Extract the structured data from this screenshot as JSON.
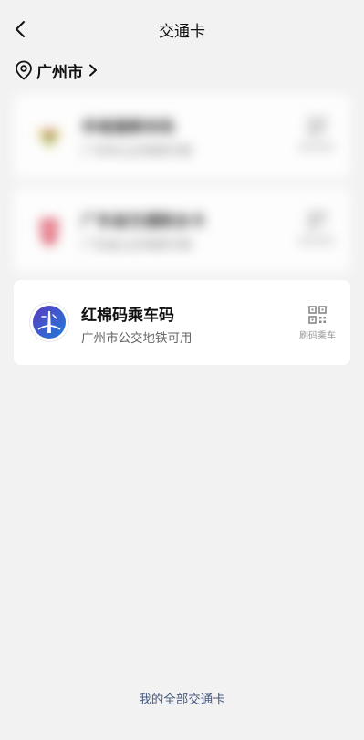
{
  "header": {
    "title": "交通卡"
  },
  "city": {
    "name": "广州市"
  },
  "cards": [
    {
      "title": "羊城通乘车码",
      "subtitle": "广州市公交地铁可用",
      "action_label": "刷码乘车",
      "blurred": true
    },
    {
      "title": "广东省交通联合卡",
      "subtitle": "广东省公交地铁可用",
      "action_label": "刷码乘车",
      "blurred": true
    },
    {
      "title": "红棉码乘车码",
      "subtitle": "广州市公交地铁可用",
      "action_label": "刷码乘车",
      "blurred": false
    }
  ],
  "footer": {
    "link_label": "我的全部交通卡"
  },
  "colors": {
    "background": "#f2f2f2",
    "card": "#ffffff",
    "link": "#4a5a82",
    "logo_blue": "#3a4fc4"
  },
  "icons": {
    "back": "chevron-left-icon",
    "location": "map-pin-icon",
    "city_arrow": "chevron-right-icon",
    "qr": "qr-code-icon"
  }
}
